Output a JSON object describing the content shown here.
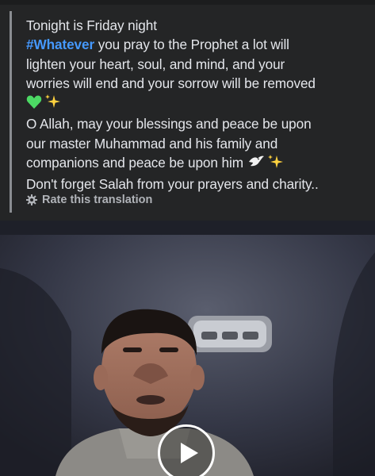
{
  "post": {
    "line1": "Tonight is Friday night",
    "hashtag": "#Whatever",
    "line2_rest": " you pray to the Prophet a lot will",
    "line3": "lighten your heart, soul, and mind, and your",
    "line4": "worries will end and your sorrow will be removed",
    "line6": "O Allah, may your blessings and peace be upon",
    "line7": "our master Muhammad and his family and",
    "line8": "companions and peace be upon him",
    "line9": "Don't forget Salah from your prayers and charity.."
  },
  "icons": {
    "heart": "green-heart-emoji",
    "sparkles": "sparkles-emoji",
    "dove": "dove-emoji",
    "gear": "gear-icon",
    "play": "play-icon"
  },
  "translation": {
    "rate_label": "Rate this translation"
  },
  "colors": {
    "background": "#242526",
    "text": "#e4e6eb",
    "hashtag": "#4599ff",
    "muted": "#b0b3b8",
    "quote_bar": "#8a8d91",
    "heart": "#4cd964",
    "sparkle": "#ffd23f"
  }
}
